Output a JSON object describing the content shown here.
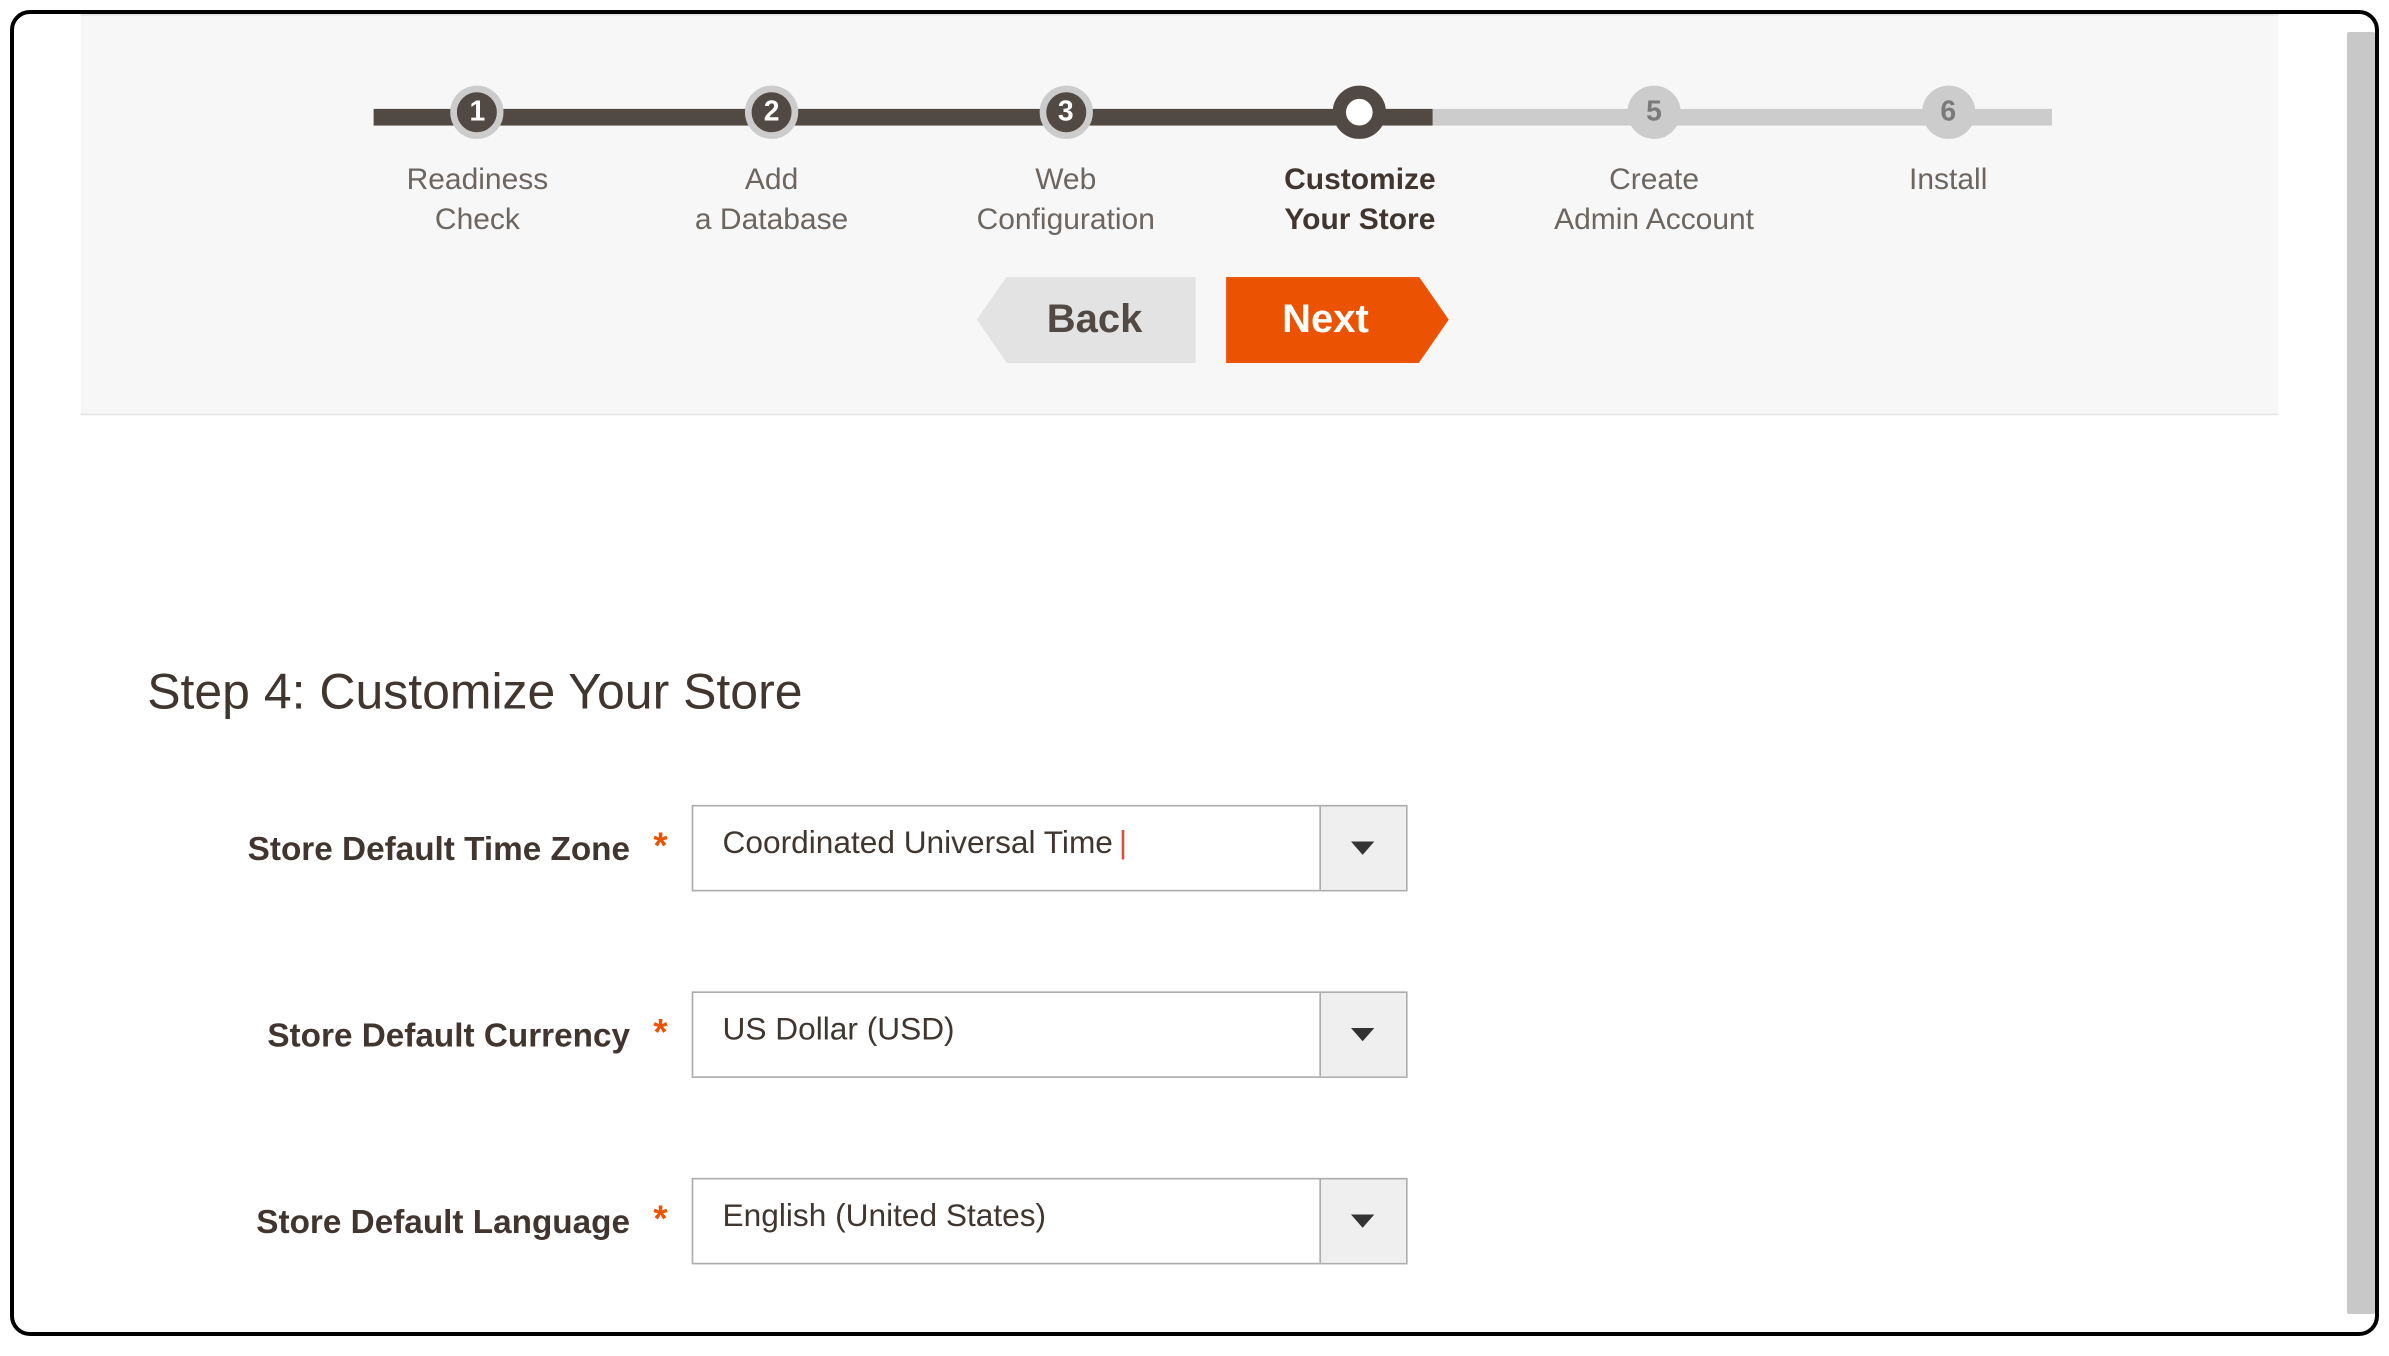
{
  "stepper": {
    "steps": [
      {
        "num": "1",
        "label": "Readiness\nCheck",
        "state": "done"
      },
      {
        "num": "2",
        "label": "Add\na Database",
        "state": "done"
      },
      {
        "num": "3",
        "label": "Web\nConfiguration",
        "state": "done"
      },
      {
        "num": "",
        "label": "Customize\nYour Store",
        "state": "current"
      },
      {
        "num": "5",
        "label": "Create\nAdmin Account",
        "state": "upcoming"
      },
      {
        "num": "6",
        "label": "Install",
        "state": "upcoming"
      }
    ],
    "progress_percent": 60
  },
  "nav": {
    "back_label": "Back",
    "next_label": "Next"
  },
  "page": {
    "title": "Step 4: Customize Your Store"
  },
  "form": {
    "timezone": {
      "label": "Store Default Time Zone",
      "value": "Coordinated Universal Time",
      "truncated": true
    },
    "currency": {
      "label": "Store Default Currency",
      "value": "US Dollar (USD)",
      "truncated": false
    },
    "language": {
      "label": "Store Default Language",
      "value": "English (United States)",
      "truncated": false
    }
  }
}
